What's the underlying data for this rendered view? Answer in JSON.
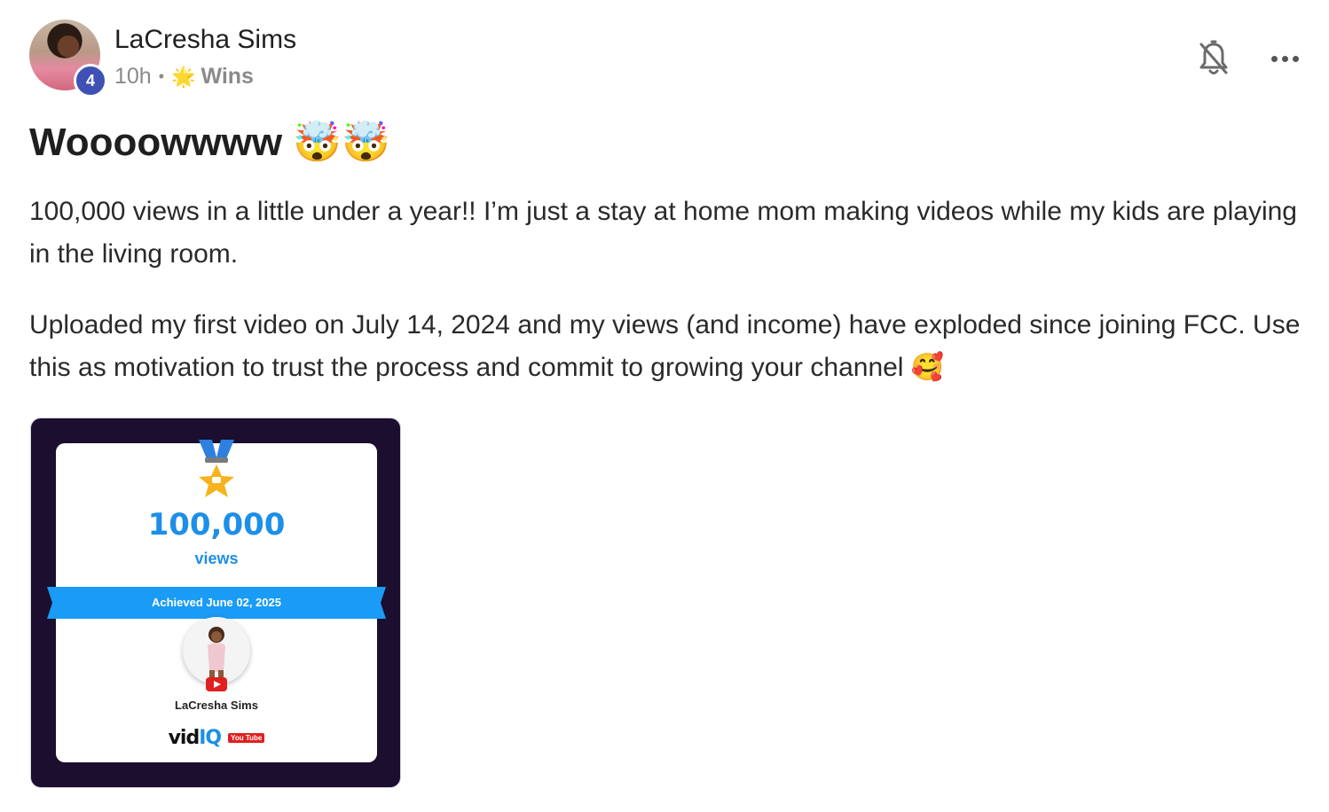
{
  "author": {
    "name": "LaCresha Sims",
    "level": "4",
    "time_ago": "10h",
    "separator": "•",
    "category_emoji": "🌟",
    "category": "Wins"
  },
  "post": {
    "title": "Woooowwww 🤯🤯",
    "paragraph_1": "100,000 views in a little under a year!! I’m just a stay at home mom making videos while my kids are playing in the living room.",
    "paragraph_2": "Uploaded my first video on July 14, 2024 and my views (and income) have exploded since joining FCC. Use this as motivation to trust the process and commit to growing your channel 🥰"
  },
  "achievement_image": {
    "count": "100,000",
    "unit": "views",
    "achieved": "Achieved June 02, 2025",
    "channel_name": "LaCresha Sims",
    "brand_vid": "vid",
    "brand_iq": "IQ",
    "brand_badge": "You Tube"
  },
  "icons": {
    "bell": "bell-off-icon",
    "more": "more-horizontal-icon"
  },
  "colors": {
    "level_badge": "#3f51b5",
    "accent_blue": "#1d8fe6",
    "image_frame": "#1b0e2e",
    "muted_text": "#8a8a8a"
  }
}
